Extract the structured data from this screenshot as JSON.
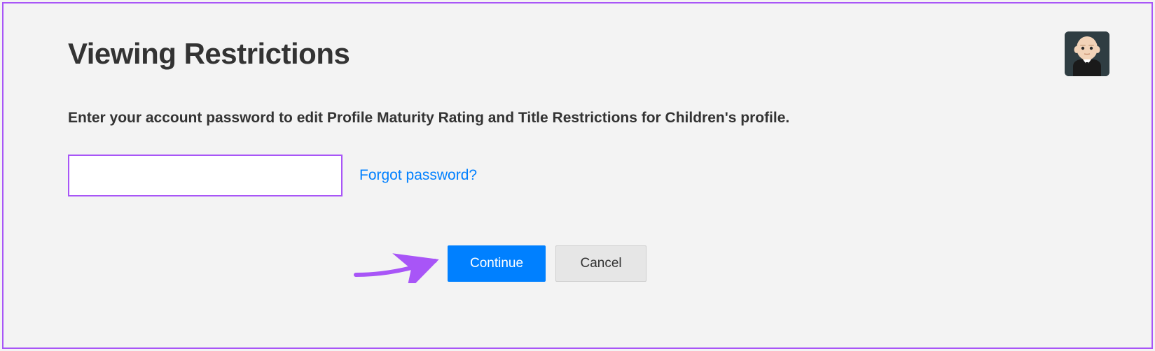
{
  "header": {
    "title": "Viewing Restrictions"
  },
  "instruction": "Enter your account password to edit Profile Maturity Rating and Title Restrictions for Children's profile.",
  "password": {
    "value": "",
    "forgot_label": "Forgot password?"
  },
  "buttons": {
    "continue_label": "Continue",
    "cancel_label": "Cancel"
  }
}
